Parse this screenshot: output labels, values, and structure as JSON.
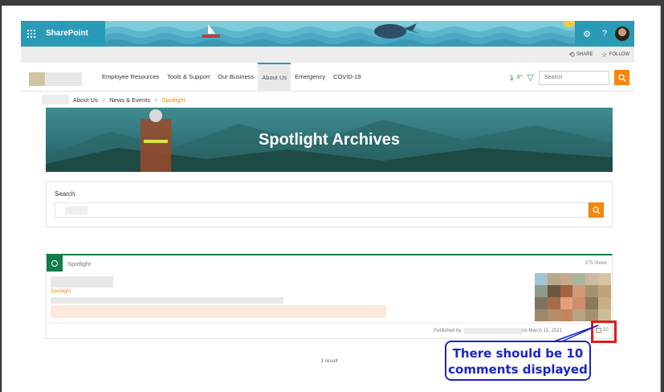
{
  "suite": {
    "brand": "SharePoint"
  },
  "actions": {
    "share": "SHARE",
    "follow": "FOLLOW"
  },
  "nav": {
    "items": [
      {
        "label": "Employee Resources",
        "active": false
      },
      {
        "label": "Tools & Support",
        "active": false
      },
      {
        "label": "Our Business",
        "active": false
      },
      {
        "label": "About Us",
        "active": true
      },
      {
        "label": "Emergency",
        "active": false
      },
      {
        "label": "COVID-19",
        "active": false
      }
    ],
    "weather": "8°",
    "search_placeholder": "Search"
  },
  "breadcrumb": {
    "items": [
      "About Us",
      "News & Events"
    ],
    "current": "Spotlight",
    "separator": ">"
  },
  "hero": {
    "title": "Spotlight Archives"
  },
  "search_card": {
    "label": "Search"
  },
  "result": {
    "category": "Spotlight",
    "views": "375 Views",
    "tag": "Spotlight",
    "published_prefix": "Published by",
    "published_date": "on March 15, 2021",
    "comment_count": "10"
  },
  "results_summary": "1 result",
  "annotation": {
    "line1": "There should be 10",
    "line2": "comments displayed"
  },
  "colors": {
    "accent": "#f7860d",
    "brand": "#2a9bb6",
    "green": "#127a4b",
    "annotation_blue": "#1a24c9",
    "annotation_red": "#e21b1b"
  }
}
